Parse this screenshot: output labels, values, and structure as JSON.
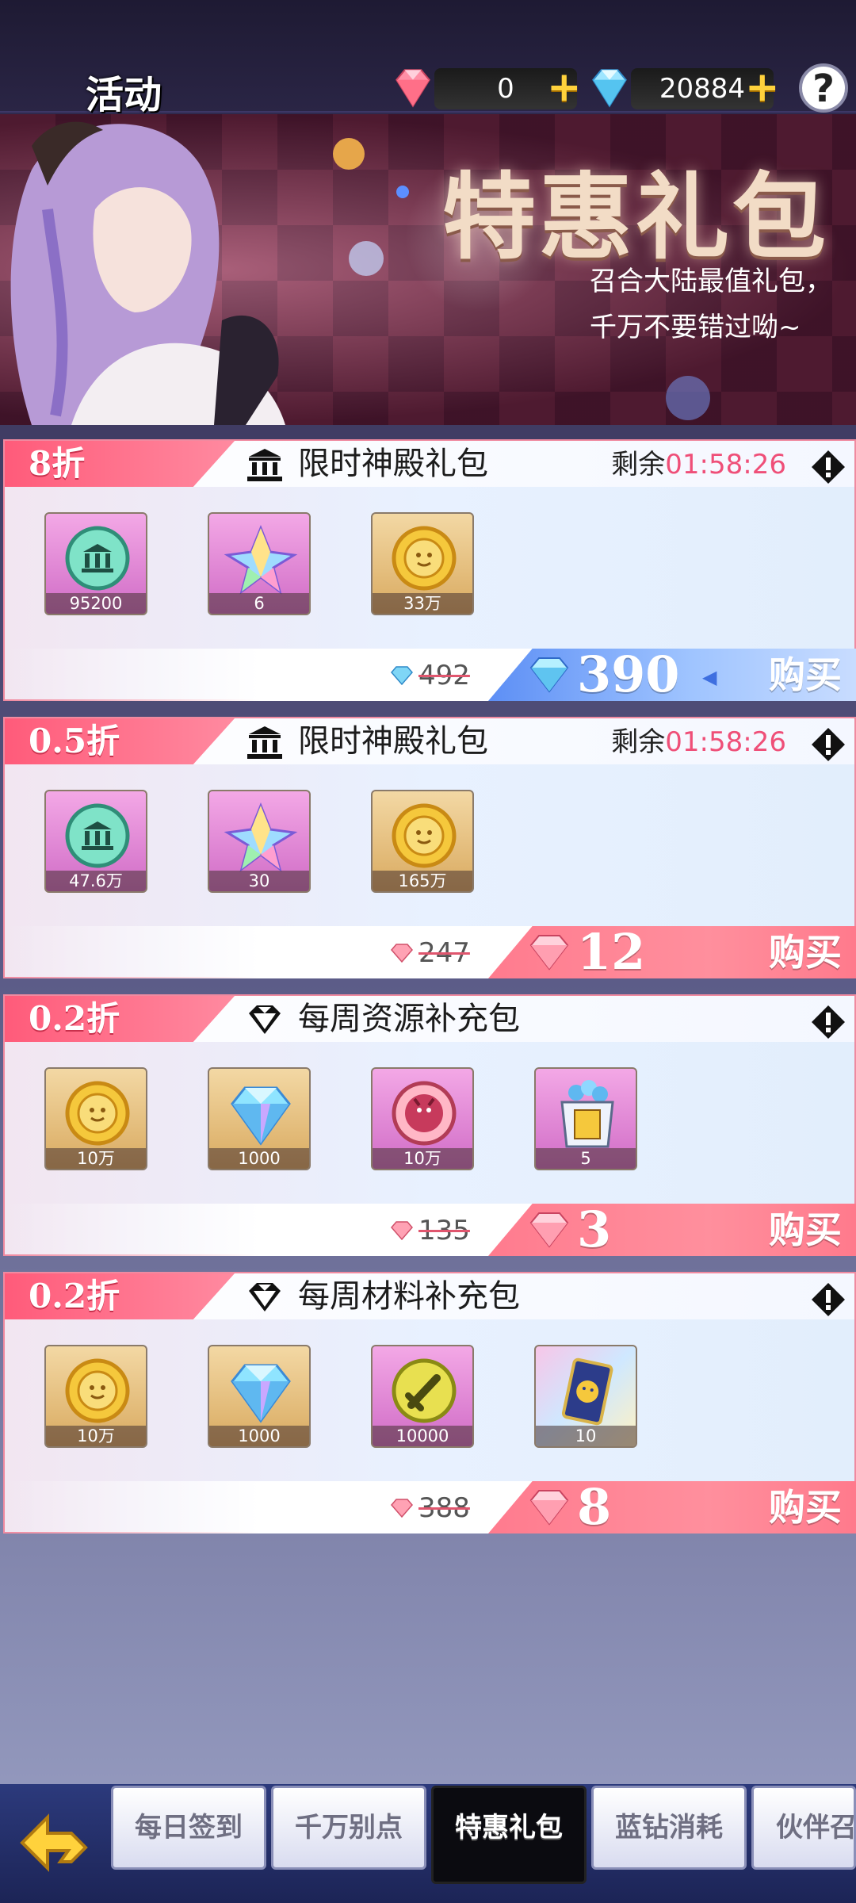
{
  "header": {
    "title": "活动",
    "currency_pink": "0",
    "currency_blue": "20884",
    "help_label": "?"
  },
  "banner": {
    "title": "特惠礼包",
    "subtitle_line1": "召合大陆最值礼包，",
    "subtitle_line2": "千万不要错过呦~"
  },
  "offers": [
    {
      "discount": "8折",
      "title": "限时神殿礼包",
      "icon": "temple-icon",
      "timer_label": "剩余",
      "timer_value": "01:58:26",
      "items": [
        {
          "icon": "temple-coin-icon",
          "qty": "95200"
        },
        {
          "icon": "rainbow-crystal-icon",
          "qty": "6"
        },
        {
          "icon": "gold-coin-icon",
          "qty": "33万"
        }
      ],
      "old_price": "492",
      "price": "390",
      "buy_label": "购买",
      "button_style": "blue"
    },
    {
      "discount": "0.5折",
      "title": "限时神殿礼包",
      "icon": "temple-icon",
      "timer_label": "剩余",
      "timer_value": "01:58:26",
      "items": [
        {
          "icon": "temple-coin-icon",
          "qty": "47.6万"
        },
        {
          "icon": "rainbow-crystal-icon",
          "qty": "30"
        },
        {
          "icon": "gold-coin-icon",
          "qty": "165万"
        }
      ],
      "old_price": "247",
      "price": "12",
      "buy_label": "购买",
      "button_style": "pink"
    },
    {
      "discount": "0.2折",
      "title": "每周资源补充包",
      "icon": "diamond-icon",
      "timer_label": "",
      "timer_value": "",
      "items": [
        {
          "icon": "gold-coin-icon",
          "qty": "10万"
        },
        {
          "icon": "blue-diamond-icon",
          "qty": "1000"
        },
        {
          "icon": "red-orb-icon",
          "qty": "10万"
        },
        {
          "icon": "treasure-box-icon",
          "qty": "5"
        }
      ],
      "old_price": "135",
      "price": "3",
      "buy_label": "购买",
      "button_style": "pink"
    },
    {
      "discount": "0.2折",
      "title": "每周材料补充包",
      "icon": "diamond-icon",
      "timer_label": "",
      "timer_value": "",
      "items": [
        {
          "icon": "gold-coin-icon",
          "qty": "10万"
        },
        {
          "icon": "blue-diamond-icon",
          "qty": "1000"
        },
        {
          "icon": "sword-coin-icon",
          "qty": "10000"
        },
        {
          "icon": "card-icon",
          "qty": "10"
        }
      ],
      "old_price": "388",
      "price": "8",
      "buy_label": "购买",
      "button_style": "pink"
    }
  ],
  "bottom_nav": {
    "tabs": [
      {
        "label": "每日签到",
        "active": false
      },
      {
        "label": "千万别点",
        "active": false
      },
      {
        "label": "特惠礼包",
        "active": true
      },
      {
        "label": "蓝钻消耗",
        "active": false
      },
      {
        "label": "伙伴召",
        "active": false
      }
    ]
  },
  "colors": {
    "accent_pink": "#ff6f86",
    "timer_pink": "#ef4f78",
    "buy_blue": "#5d8ff5"
  }
}
